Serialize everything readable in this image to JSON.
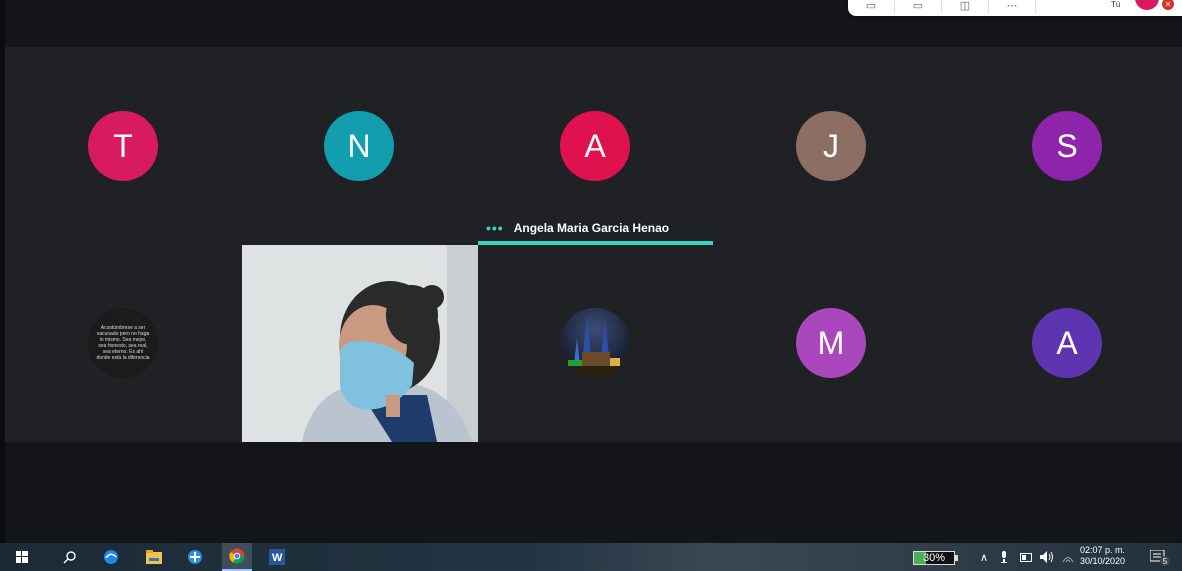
{
  "meeting": {
    "participants_row1": [
      {
        "initial": "T",
        "color": "#d81b60"
      },
      {
        "initial": "N",
        "color": "#129eaf"
      },
      {
        "initial": "A",
        "color": "#e0114f"
      },
      {
        "initial": "J",
        "color": "#8d6e63"
      },
      {
        "initial": "S",
        "color": "#8e24aa"
      }
    ],
    "participants_row2": [
      {
        "initial": "M",
        "color": "#ab47bc"
      },
      {
        "initial": "A",
        "color": "#5e35b1"
      }
    ],
    "quote_text": "Acostúmbrese a ser vacunado pero no haga lo mismo. Sea mejor, sea honesto, sea real, sea eterno. Es ahí donde está la diferencia",
    "active_speaker": "Angela Maria Garcia Henao",
    "accent_color": "#39d3c4"
  },
  "topbar": {
    "self_label": "Tú"
  },
  "taskbar": {
    "battery_percent": 30,
    "battery_text": "30%",
    "time": "02:07 p. m.",
    "date": "30/10/2020",
    "notification_count": "5"
  }
}
